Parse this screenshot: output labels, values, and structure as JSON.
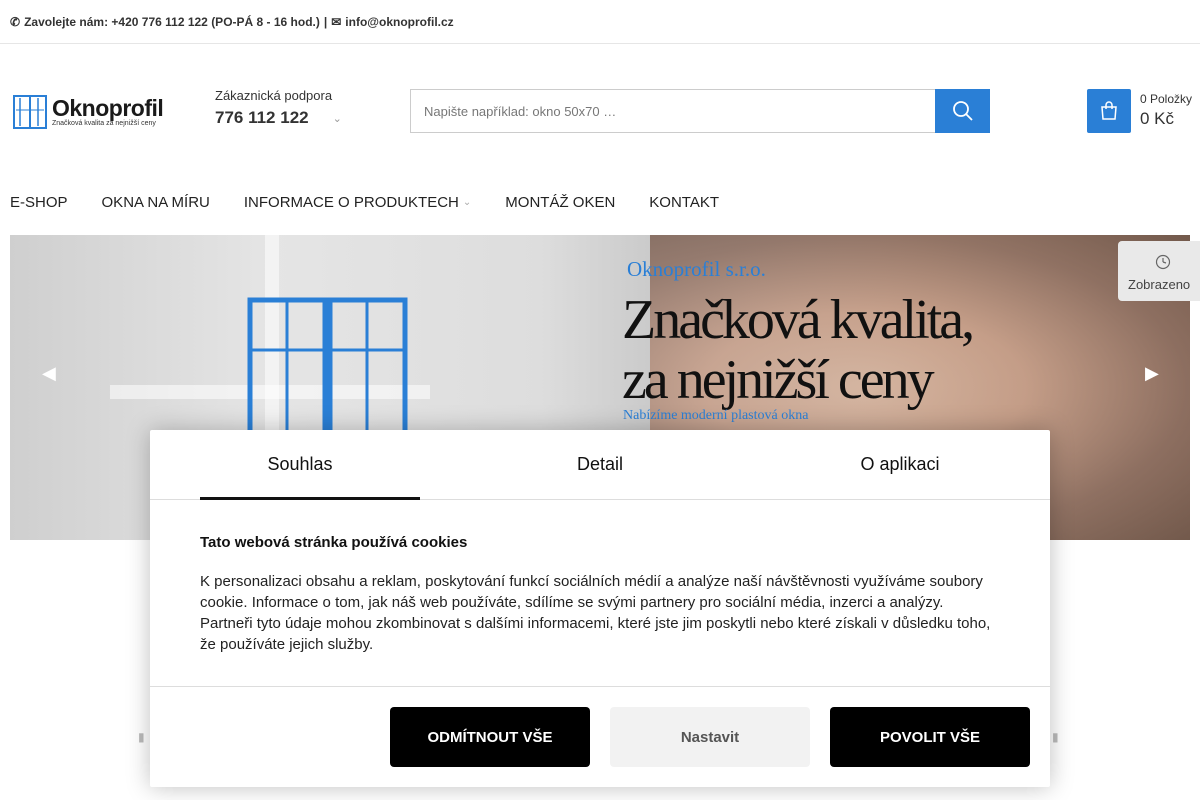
{
  "topbar": {
    "phone_text": "Zavolejte nám: +420 776 112 122 (PO-PÁ 8 - 16 hod.)",
    "separator": "|",
    "email": "info@oknoprofil.cz"
  },
  "logo": {
    "brand": "Oknoprofil",
    "tagline": "Značková kvalita za nejnižší ceny"
  },
  "support": {
    "label": "Zákaznická podpora",
    "phone": "776 112 122"
  },
  "search": {
    "placeholder": "Napište například: okno 50x70 …"
  },
  "cart": {
    "items": "0 Položky",
    "price": "0 Kč"
  },
  "nav": {
    "items": [
      {
        "label": "E-SHOP"
      },
      {
        "label": "OKNA NA MÍRU"
      },
      {
        "label": "INFORMACE O PRODUKTECH"
      },
      {
        "label": "MONTÁŽ OKEN"
      },
      {
        "label": "KONTAKT"
      }
    ]
  },
  "hero": {
    "company": "Oknoprofil s.r.o.",
    "headline_line1": "Značková kvalita,",
    "headline_line2": "za nejnižší ceny",
    "subtitle": "Nabízíme moderní plastová okna"
  },
  "viewed": {
    "label": "Zobrazeno"
  },
  "cookie": {
    "tabs": [
      "Souhlas",
      "Detail",
      "O aplikaci"
    ],
    "active_tab": "Souhlas",
    "title": "Tato webová stránka používá cookies",
    "text": "K personalizaci obsahu a reklam, poskytování funkcí sociálních médií a analýze naší návštěvnosti využíváme soubory cookie. Informace o tom, jak náš web používáte, sdílíme se svými partnery pro sociální média, inzerci a analýzy. Partneři tyto údaje mohou zkombinovat s dalšími informacemi, které jste jim poskytli nebo které získali v důsledku toho, že používáte jejich služby.",
    "reject_label": "ODMÍTNOUT VŠE",
    "settings_label": "Nastavit",
    "accept_label": "POVOLIT VŠE"
  },
  "colors": {
    "accent": "#2a7fd6",
    "button_dark": "#000000"
  },
  "icons": {
    "phone": "phone-icon",
    "email": "envelope-icon",
    "search": "search-icon",
    "cart": "shopping-bag-icon",
    "viewed": "clock-icon",
    "prev": "chevron-left-icon",
    "next": "chevron-right-icon"
  }
}
